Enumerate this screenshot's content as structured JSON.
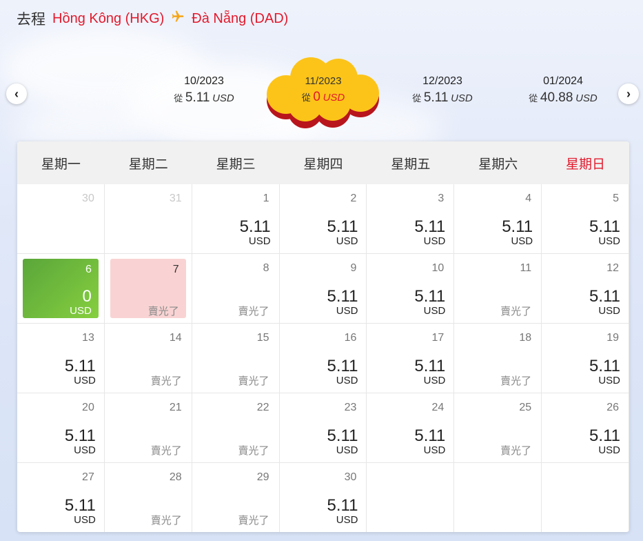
{
  "header": {
    "direction": "去程",
    "origin": "Hồng Kông (HKG)",
    "destination": "Đà Nẵng (DAD)",
    "plane_icon": "plane-icon"
  },
  "months": [
    {
      "label": "10/2023",
      "prefix": "從",
      "price": "5.11",
      "currency": "USD",
      "active": false
    },
    {
      "label": "11/2023",
      "prefix": "從",
      "price": "0",
      "currency": "USD",
      "active": true
    },
    {
      "label": "12/2023",
      "prefix": "從",
      "price": "5.11",
      "currency": "USD",
      "active": false
    },
    {
      "label": "01/2024",
      "prefix": "從",
      "price": "40.88",
      "currency": "USD",
      "active": false
    }
  ],
  "nav": {
    "prev_icon": "chevron-left-icon",
    "next_icon": "chevron-right-icon",
    "prev": "‹",
    "next": "›"
  },
  "weekdays": [
    "星期一",
    "星期二",
    "星期三",
    "星期四",
    "星期五",
    "星期六",
    "星期日"
  ],
  "colors": {
    "accent_red": "#e3192c",
    "selected_green": "#6dbb3c",
    "pink": "#f9d3d3",
    "gold": "#fcc419"
  },
  "calendar": {
    "sold_out_text": "賣光了",
    "weeks": [
      [
        {
          "date": "30",
          "other": true
        },
        {
          "date": "31",
          "other": true
        },
        {
          "date": "1",
          "price": "5.11",
          "currency": "USD"
        },
        {
          "date": "2",
          "price": "5.11",
          "currency": "USD"
        },
        {
          "date": "3",
          "price": "5.11",
          "currency": "USD"
        },
        {
          "date": "4",
          "price": "5.11",
          "currency": "USD"
        },
        {
          "date": "5",
          "price": "5.11",
          "currency": "USD"
        }
      ],
      [
        {
          "date": "6",
          "price": "0",
          "currency": "USD",
          "selected": true
        },
        {
          "date": "7",
          "sold": "賣光了",
          "pink": true
        },
        {
          "date": "8",
          "sold": "賣光了"
        },
        {
          "date": "9",
          "price": "5.11",
          "currency": "USD"
        },
        {
          "date": "10",
          "price": "5.11",
          "currency": "USD"
        },
        {
          "date": "11",
          "sold": "賣光了"
        },
        {
          "date": "12",
          "price": "5.11",
          "currency": "USD"
        }
      ],
      [
        {
          "date": "13",
          "price": "5.11",
          "currency": "USD"
        },
        {
          "date": "14",
          "sold": "賣光了"
        },
        {
          "date": "15",
          "sold": "賣光了"
        },
        {
          "date": "16",
          "price": "5.11",
          "currency": "USD"
        },
        {
          "date": "17",
          "price": "5.11",
          "currency": "USD"
        },
        {
          "date": "18",
          "sold": "賣光了"
        },
        {
          "date": "19",
          "price": "5.11",
          "currency": "USD"
        }
      ],
      [
        {
          "date": "20",
          "price": "5.11",
          "currency": "USD"
        },
        {
          "date": "21",
          "sold": "賣光了"
        },
        {
          "date": "22",
          "sold": "賣光了"
        },
        {
          "date": "23",
          "price": "5.11",
          "currency": "USD"
        },
        {
          "date": "24",
          "price": "5.11",
          "currency": "USD"
        },
        {
          "date": "25",
          "sold": "賣光了"
        },
        {
          "date": "26",
          "price": "5.11",
          "currency": "USD"
        }
      ],
      [
        {
          "date": "27",
          "price": "5.11",
          "currency": "USD"
        },
        {
          "date": "28",
          "sold": "賣光了"
        },
        {
          "date": "29",
          "sold": "賣光了"
        },
        {
          "date": "30",
          "price": "5.11",
          "currency": "USD"
        },
        {
          "empty": true
        },
        {
          "empty": true
        },
        {
          "empty": true
        }
      ]
    ]
  }
}
